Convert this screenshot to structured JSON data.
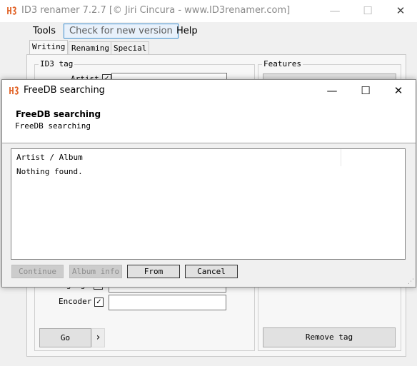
{
  "main_window": {
    "title": "ID3 renamer 7.2.7 [© Jiri Cincura - www.ID3renamer.com]",
    "controls": {
      "minimize": "—",
      "maximize": "☐",
      "close": "✕"
    },
    "menu": {
      "tools": "Tools",
      "check_version": "Check for new version",
      "help": "Help"
    },
    "tabs": [
      "Writing",
      "Renaming",
      "Special"
    ],
    "id3_tag_group": {
      "label": "ID3 tag",
      "artist_label": "Artist",
      "language_label": "Language",
      "encoder_label": "Encoder"
    },
    "features_group": {
      "label": "Features"
    },
    "go_button": "Go",
    "go_arrow": "›",
    "remove_tag_button": "Remove tag"
  },
  "dialog": {
    "title": "FreeDB searching",
    "heading": "FreeDB searching",
    "subheading": "FreeDB searching",
    "controls": {
      "minimize": "—",
      "maximize": "☐",
      "close": "✕"
    },
    "list": {
      "column_header": "Artist / Album",
      "result": "Nothing found."
    },
    "buttons": {
      "continue": "Continue",
      "album_info": "Album info",
      "from": "From",
      "cancel": "Cancel"
    },
    "resize_grip": "⋰"
  },
  "colors": {
    "app_icon": "#e2652a",
    "focus_border": "#3c8fd0"
  }
}
